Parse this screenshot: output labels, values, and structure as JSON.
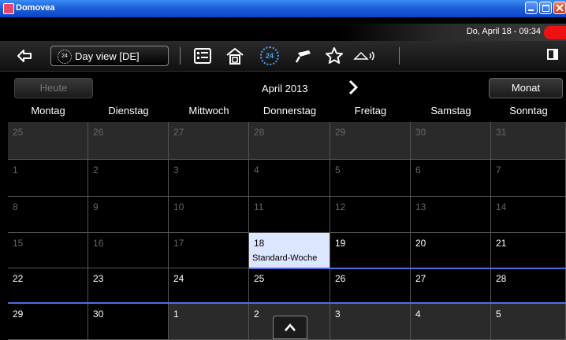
{
  "window": {
    "title": "Domovea"
  },
  "status": {
    "datetime": "Do, April 18 - 09:34"
  },
  "toolbar": {
    "view_selector": {
      "label": "Day view [DE]",
      "icon_text": "24"
    },
    "icons": [
      "back-arrow-icon",
      "list-icon",
      "home-icon",
      "timer-24-icon",
      "camera-icon",
      "star-icon",
      "sound-icon",
      "panel-icon"
    ],
    "clock_icon_text": "24"
  },
  "calendar": {
    "today_button": "Heute",
    "month_title": "April 2013",
    "month_button": "Monat",
    "weekdays": [
      "Montag",
      "Dienstag",
      "Mittwoch",
      "Donnerstag",
      "Freitag",
      "Samstag",
      "Sonntag"
    ],
    "weeks": [
      [
        "25",
        "26",
        "27",
        "28",
        "29",
        "30",
        "31"
      ],
      [
        "1",
        "2",
        "3",
        "4",
        "5",
        "6",
        "7"
      ],
      [
        "8",
        "9",
        "10",
        "11",
        "12",
        "13",
        "14"
      ],
      [
        "15",
        "16",
        "17",
        "18",
        "19",
        "20",
        "21"
      ],
      [
        "22",
        "23",
        "24",
        "25",
        "26",
        "27",
        "28"
      ],
      [
        "29",
        "30",
        "1",
        "2",
        "3",
        "4",
        "5"
      ]
    ],
    "today": {
      "day": "18",
      "event": "Standard-Woche"
    }
  },
  "colors": {
    "accent": "#4b6fe0",
    "today_bg": "#dde6ff",
    "titlebar": "#1e5fd8",
    "alarm": "#ee1111"
  }
}
